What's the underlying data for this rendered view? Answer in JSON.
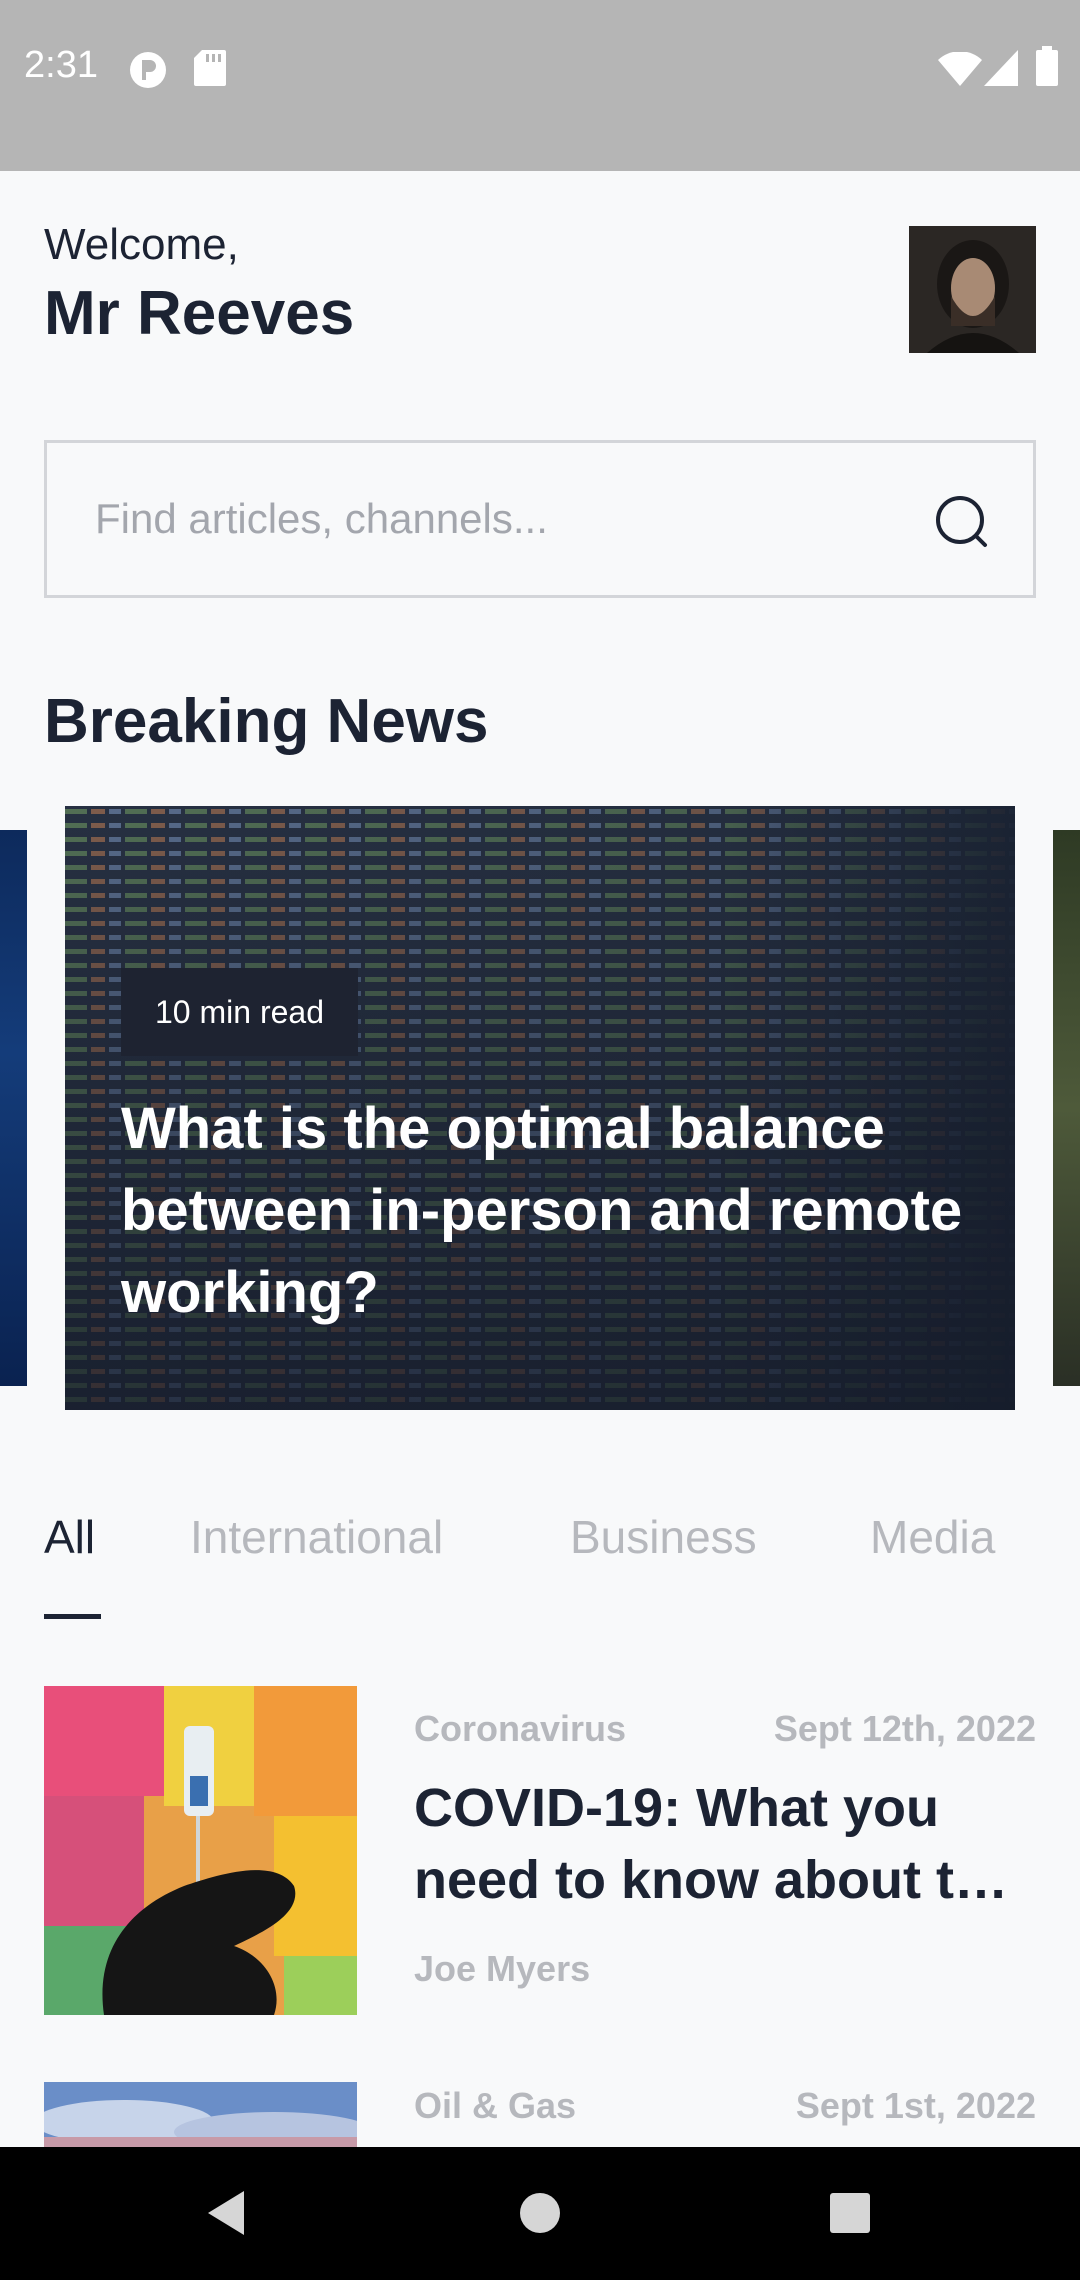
{
  "status_bar": {
    "time": "2:31"
  },
  "header": {
    "greeting": "Welcome,",
    "user_name": "Mr Reeves"
  },
  "search": {
    "placeholder": "Find articles, channels..."
  },
  "breaking_news": {
    "title": "Breaking News",
    "featured": {
      "read_time": "10 min read",
      "title": "What is the optimal balance between in-person and remote working?"
    }
  },
  "tabs": [
    "All",
    "International",
    "Business",
    "Media"
  ],
  "articles": [
    {
      "category": "Coronavirus",
      "date": "Sept 12th, 2022",
      "title_line1": "COVID-19: What you",
      "title_line2": "need to know about the vaccine",
      "author": "Joe Myers"
    },
    {
      "category": "Oil & Gas",
      "date": "Sept 1st, 2022"
    }
  ],
  "colors": {
    "text": "#1c2333",
    "muted": "#b6b8bd",
    "background": "#f8f9fa"
  }
}
